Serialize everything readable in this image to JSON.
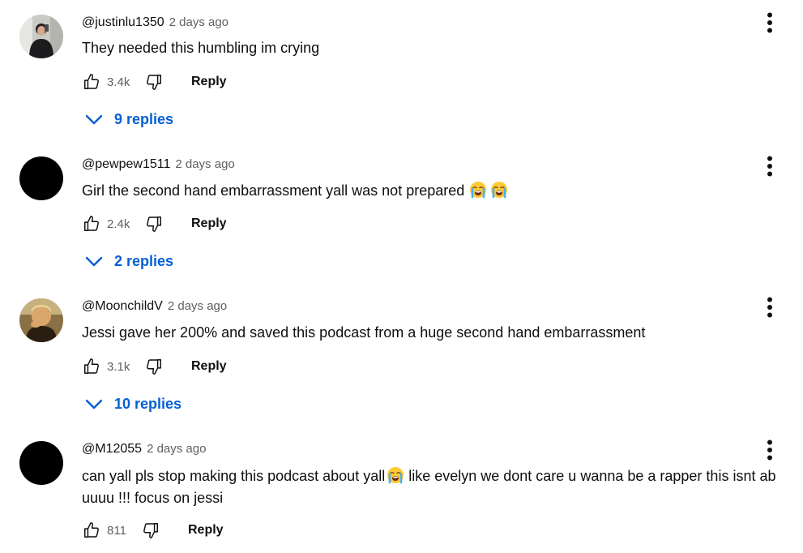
{
  "comments": [
    {
      "author": "@justinlu1350",
      "time": "2 days ago",
      "text": "They needed this humbling im crying",
      "emoji_count": 0,
      "likes": "3.4k",
      "reply_label": "Reply",
      "replies_label": "9 replies",
      "avatar": "photo-person-mirror"
    },
    {
      "author": "@pewpew1511",
      "time": "2 days ago",
      "text": "Girl the second hand embarrassment yall was not prepared",
      "emoji_count": 2,
      "emoji": "loudly-crying-face",
      "likes": "2.4k",
      "reply_label": "Reply",
      "replies_label": "2 replies",
      "avatar": "black"
    },
    {
      "author": "@MoonchildV",
      "time": "2 days ago",
      "text": "Jessi gave her 200% and saved this podcast from a huge second hand embarrassment",
      "emoji_count": 0,
      "likes": "3.1k",
      "reply_label": "Reply",
      "replies_label": "10 replies",
      "avatar": "photo-person-sepia"
    },
    {
      "author": "@M12055",
      "time": "2 days ago",
      "text_before_emoji": "can yall pls stop making this podcast about yall",
      "text_after_emoji": " like evelyn we dont care u wanna be a rapper this isnt ab uuuu !!! focus on jessi",
      "emoji": "loudly-crying-face",
      "likes": "811",
      "reply_label": "Reply",
      "avatar": "black"
    }
  ],
  "colors": {
    "text": "#0f0f0f",
    "secondary": "#606060",
    "link_blue": "#065fd4",
    "background": "#ffffff"
  },
  "icons": [
    "thumbs-up-icon",
    "thumbs-down-icon",
    "chevron-down-icon",
    "more-vert-icon",
    "loudly-crying-face-emoji"
  ]
}
